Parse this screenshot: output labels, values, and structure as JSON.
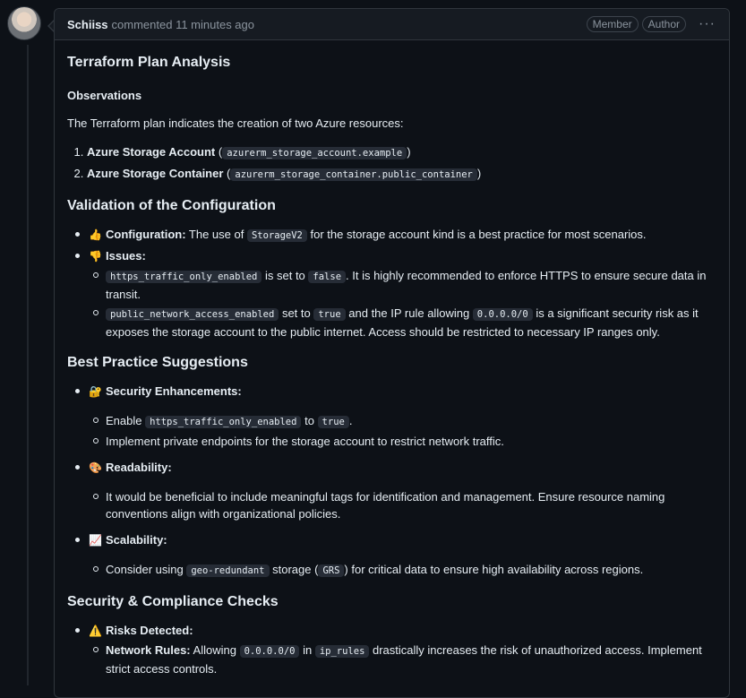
{
  "comment": {
    "author": "Schiiss",
    "meta": "commented 11 minutes ago",
    "badges": [
      "Member",
      "Author"
    ],
    "more_menu": "···"
  },
  "content": {
    "title": "Terraform Plan Analysis",
    "observations": {
      "heading": "Observations",
      "intro": "The Terraform plan indicates the creation of two Azure resources:",
      "resources": [
        {
          "name": "Azure Storage Account",
          "open": " (",
          "code": "azurerm_storage_account.example",
          "close": ")"
        },
        {
          "name": "Azure Storage Container",
          "open": " (",
          "code": "azurerm_storage_container.public_container",
          "close": ")"
        }
      ]
    },
    "validation": {
      "heading": "Validation of the Configuration",
      "config": {
        "emoji": "👍",
        "label": "Configuration:",
        "t1": " The use of ",
        "code": "StorageV2",
        "t2": " for the storage account kind is a best practice for most scenarios."
      },
      "issues": {
        "emoji": "👎",
        "label": "Issues:",
        "i1": {
          "code1": "https_traffic_only_enabled",
          "t1": " is set to ",
          "code2": "false",
          "t2": ". It is highly recommended to enforce HTTPS to ensure secure data in transit."
        },
        "i2": {
          "code1": "public_network_access_enabled",
          "t1": " set to ",
          "code2": "true",
          "t2": " and the IP rule allowing ",
          "code3": "0.0.0.0/0",
          "t3": " is a significant security risk as it exposes the storage account to the public internet. Access should be restricted to necessary IP ranges only."
        }
      }
    },
    "best_practice": {
      "heading": "Best Practice Suggestions",
      "security": {
        "emoji": "🔐",
        "label": "Security Enhancements:",
        "s1": {
          "t1": "Enable ",
          "code1": "https_traffic_only_enabled",
          "t2": " to ",
          "code2": "true",
          "t3": "."
        },
        "s2": "Implement private endpoints for the storage account to restrict network traffic."
      },
      "readability": {
        "emoji": "🎨",
        "label": "Readability:",
        "r1": "It would be beneficial to include meaningful tags for identification and management. Ensure resource naming conventions align with organizational policies."
      },
      "scalability": {
        "emoji": "📈",
        "label": "Scalability:",
        "c1": {
          "t1": "Consider using ",
          "code1": "geo-redundant",
          "t2": " storage (",
          "code2": "GRS",
          "t3": ") for critical data to ensure high availability across regions."
        }
      }
    },
    "security_compliance": {
      "heading": "Security & Compliance Checks",
      "risks": {
        "emoji": "⚠️",
        "label": "Risks Detected:",
        "n1": {
          "label": "Network Rules:",
          "t1": " Allowing ",
          "code1": "0.0.0.0/0",
          "t2": " in ",
          "code2": "ip_rules",
          "t3": " drastically increases the risk of unauthorized access. Implement strict access controls."
        }
      }
    }
  },
  "colors": {
    "background": "#0d1117",
    "header": "#161b22",
    "border": "#30363d",
    "text": "#e6edf3",
    "muted": "#8b949e"
  }
}
